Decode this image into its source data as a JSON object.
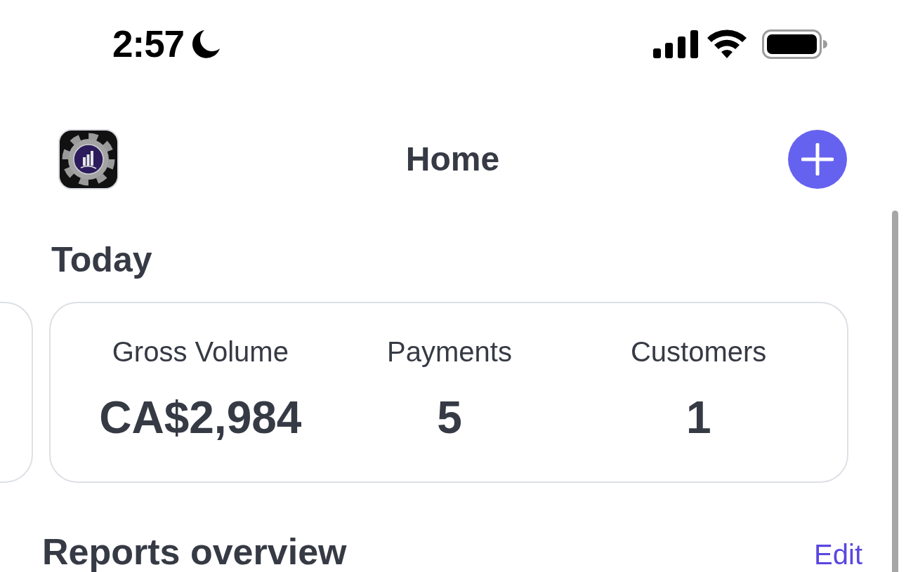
{
  "status_bar": {
    "time": "2:57",
    "focus_on": true
  },
  "header": {
    "title": "Home"
  },
  "today": {
    "heading": "Today",
    "metrics": [
      {
        "label": "Gross Volume",
        "value": "CA$2,984"
      },
      {
        "label": "Payments",
        "value": "5"
      },
      {
        "label": "Customers",
        "value": "1"
      }
    ]
  },
  "reports": {
    "heading": "Reports overview",
    "action": "Edit"
  }
}
